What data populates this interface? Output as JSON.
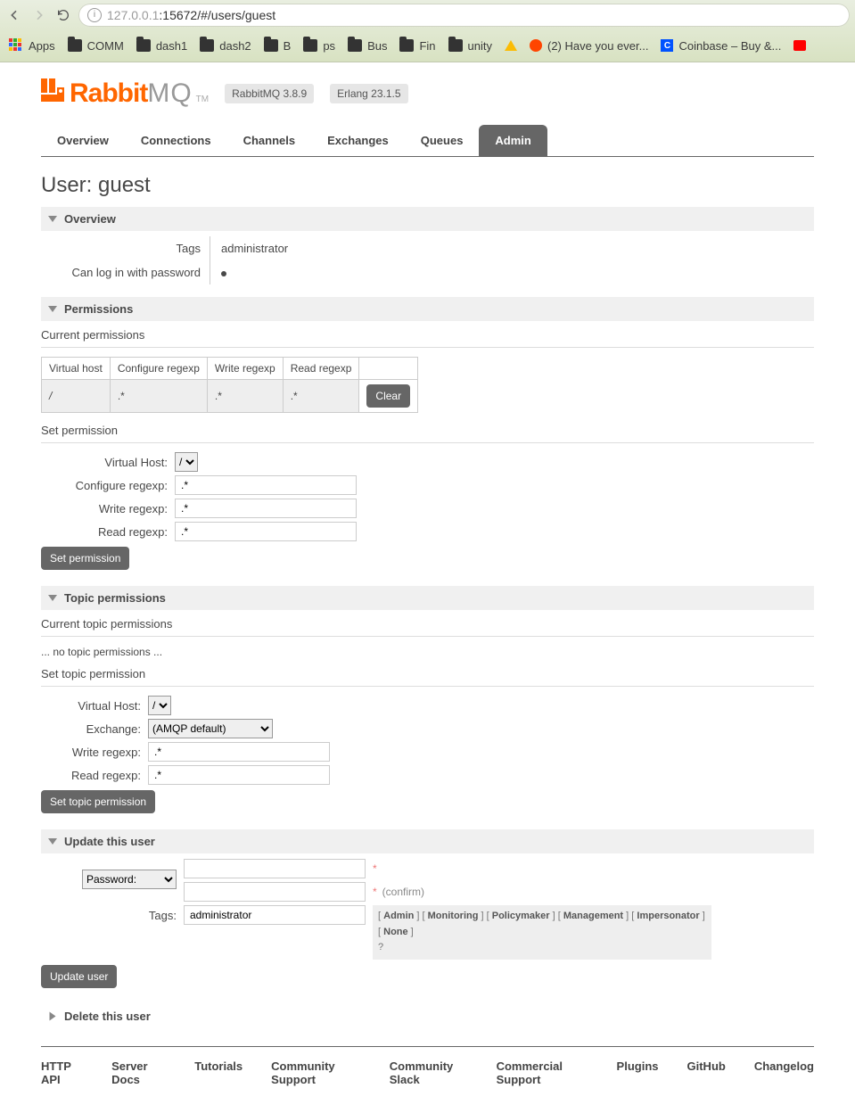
{
  "browser": {
    "url_gray": "127.0.0.1",
    "url_rest": ":15672/#/users/guest",
    "bookmarks": [
      "Apps",
      "COMM",
      "dash1",
      "dash2",
      "B",
      "ps",
      "Bus",
      "Fin",
      "unity"
    ],
    "bm_reddit": "(2) Have you ever...",
    "bm_coinbase": "Coinbase – Buy &..."
  },
  "header": {
    "brand1": "Rabbit",
    "brand2": "MQ",
    "tm": "TM",
    "version": "RabbitMQ 3.8.9",
    "erlang": "Erlang 23.1.5"
  },
  "tabs": [
    "Overview",
    "Connections",
    "Channels",
    "Exchanges",
    "Queues",
    "Admin"
  ],
  "title_prefix": "User: ",
  "title_user": "guest",
  "sections": {
    "overview": "Overview",
    "permissions": "Permissions",
    "topic": "Topic permissions",
    "update": "Update this user",
    "delete": "Delete this user"
  },
  "overview": {
    "tags_label": "Tags",
    "tags_value": "administrator",
    "login_label": "Can log in with password"
  },
  "perm": {
    "current_label": "Current permissions",
    "headers": [
      "Virtual host",
      "Configure regexp",
      "Write regexp",
      "Read regexp"
    ],
    "row": {
      "vhost": "/",
      "conf": ".*",
      "write": ".*",
      "read": ".*"
    },
    "clear": "Clear",
    "set_label": "Set permission",
    "vh_label": "Virtual Host:",
    "vh_option": "/",
    "conf_label": "Configure regexp:",
    "write_label": "Write regexp:",
    "read_label": "Read regexp:",
    "default_regex": ".*",
    "set_button": "Set permission"
  },
  "topic": {
    "current_label": "Current topic permissions",
    "none": "... no topic permissions ...",
    "set_label": "Set topic permission",
    "vh_label": "Virtual Host:",
    "vh_option": "/",
    "ex_label": "Exchange:",
    "ex_option": "(AMQP default)",
    "write_label": "Write regexp:",
    "read_label": "Read regexp:",
    "default_regex": ".*",
    "set_button": "Set topic permission"
  },
  "update": {
    "pw_option": "Password:",
    "star": "*",
    "confirm": "(confirm)",
    "tags_label": "Tags:",
    "tags_value": "administrator",
    "quick_tags": [
      "Admin",
      "Monitoring",
      "Policymaker",
      "Management",
      "Impersonator",
      "None"
    ],
    "help": "?",
    "button": "Update user"
  },
  "footer": [
    "HTTP API",
    "Server Docs",
    "Tutorials",
    "Community Support",
    "Community Slack",
    "Commercial Support",
    "Plugins",
    "GitHub",
    "Changelog"
  ]
}
